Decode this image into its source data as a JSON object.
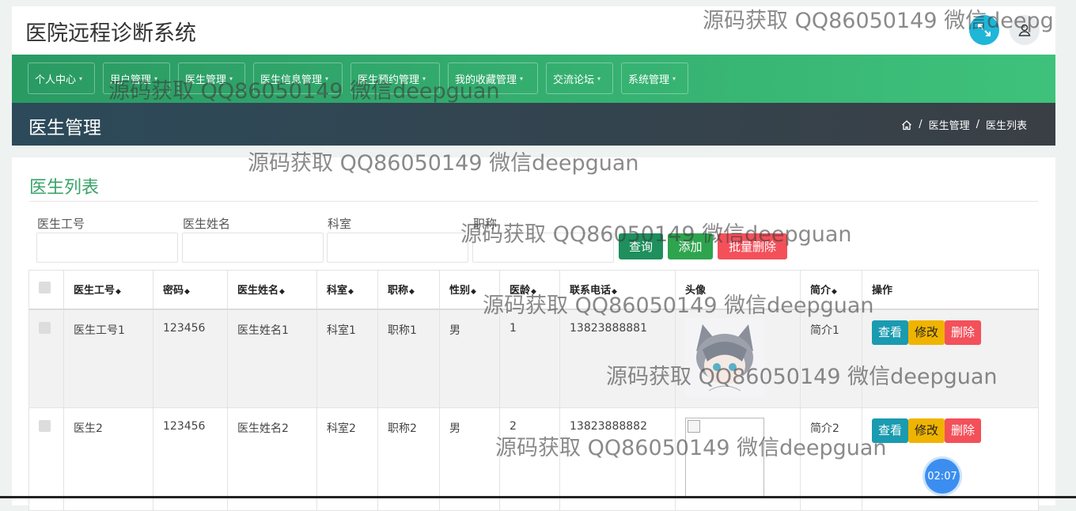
{
  "app_title": "医院远程诊断系统",
  "nav": [
    {
      "label": "个人中心"
    },
    {
      "label": "用户管理"
    },
    {
      "label": "医生管理"
    },
    {
      "label": "医生信息管理"
    },
    {
      "label": "医生预约管理"
    },
    {
      "label": "我的收藏管理"
    },
    {
      "label": "交流论坛"
    },
    {
      "label": "系统管理"
    }
  ],
  "page_title": "医生管理",
  "breadcrumb": {
    "home_icon": "home-icon",
    "level1": "医生管理",
    "separator": "/",
    "level2": "医生列表"
  },
  "card_title": "医生列表",
  "filters": {
    "doctor_no_label": "医生工号",
    "doctor_name_label": "医生姓名",
    "department_label": "科室",
    "title_label": "职称"
  },
  "buttons": {
    "query": "查询",
    "add": "添加",
    "batch_delete": "批量删除"
  },
  "colors": {
    "nav_green": "#3ec27b",
    "title_green": "#3aa36a",
    "query_btn": "#1e8f5d",
    "add_btn": "#2ea44f",
    "delete_btn": "#f3505a",
    "view_btn": "#1a9bb0",
    "edit_btn": "#f0b400"
  },
  "table": {
    "headers": [
      "医生工号",
      "密码",
      "医生姓名",
      "科室",
      "职称",
      "性别",
      "医龄",
      "联系电话",
      "头像",
      "简介",
      "操作"
    ],
    "rows": [
      {
        "doctor_no": "医生工号1",
        "password": "123456",
        "name": "医生姓名1",
        "department": "科室1",
        "title": "职称1",
        "gender": "男",
        "years": "1",
        "phone": "13823888881",
        "intro": "简介1"
      },
      {
        "doctor_no": "医生2",
        "password": "123456",
        "name": "医生姓名2",
        "department": "科室2",
        "title": "职称2",
        "gender": "男",
        "years": "2",
        "phone": "13823888882",
        "intro": "简介2"
      }
    ],
    "actions": {
      "view": "查看",
      "edit": "修改",
      "delete": "删除"
    }
  },
  "watermark": "源码获取 QQ86050149 微信deepguan",
  "watermark_cut": "源码获取 QQ86050149 微信deepg",
  "timer": "02:07"
}
